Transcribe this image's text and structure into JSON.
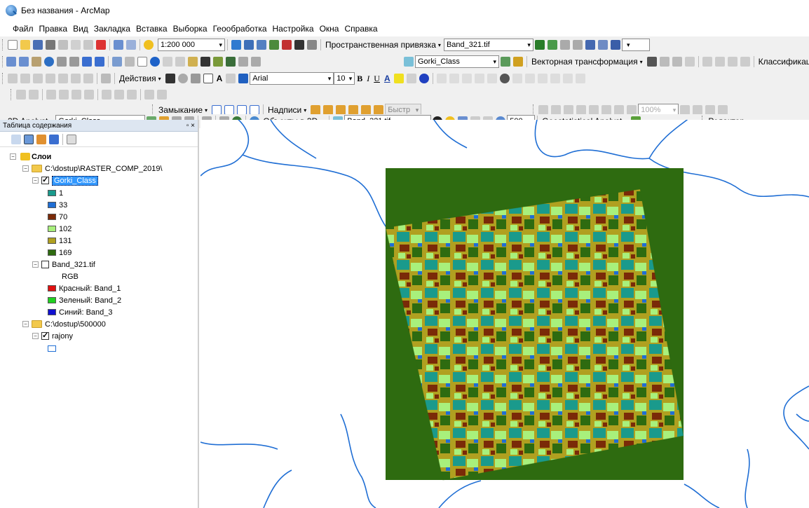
{
  "window": {
    "title": "Без названия - ArcMap"
  },
  "menu": [
    "Файл",
    "Правка",
    "Вид",
    "Закладка",
    "Вставка",
    "Выборка",
    "Геообработка",
    "Настройка",
    "Окна",
    "Справка"
  ],
  "toolbar1": {
    "scale": "1:200 000",
    "spatial_ref_label": "Пространственная привязка",
    "layer_select": "Band_321.tif"
  },
  "toolbar2": {
    "layer_select": "Gorki_Class",
    "vector_transform": "Векторная трансформация",
    "classify": "Классификаци"
  },
  "toolbar3": {
    "actions": "Действия",
    "font": "Arial",
    "font_size": "10",
    "bold": "B",
    "italic": "I",
    "underline": "U"
  },
  "toolbar5": {
    "snapping": "Замыкание",
    "labels": "Надписи",
    "fast": "Быстр",
    "zoom_pct": "100%"
  },
  "toolbar6": {
    "analyst3d": "3D Analyst",
    "layer_3d": "Gorki_Class",
    "objects3d": "Объекты в 3D...",
    "band": "Band_321.tif",
    "res": "500",
    "geostat": "Geostatistical Analyst",
    "editor": "Редактор"
  },
  "toc": {
    "title": "Таблица содержания",
    "layers_label": "Слои",
    "folder1": "C:\\dostup\\RASTER_COMP_2019\\",
    "layer_class": "Gorki_Class",
    "classes": [
      {
        "label": "1",
        "color": "#1a9a8c"
      },
      {
        "label": "33",
        "color": "#1f6ed4"
      },
      {
        "label": "70",
        "color": "#7a2a08"
      },
      {
        "label": "102",
        "color": "#a8f07c"
      },
      {
        "label": "131",
        "color": "#b0a020"
      },
      {
        "label": "169",
        "color": "#2e6b10"
      }
    ],
    "layer_band": "Band_321.tif",
    "rgb_label": "RGB",
    "bands": [
      {
        "label": "Красный:  Band_1",
        "color": "#e01010"
      },
      {
        "label": "Зеленый: Band_2",
        "color": "#20d020"
      },
      {
        "label": "Синий:  Band_3",
        "color": "#1010d0"
      }
    ],
    "folder2": "C:\\dostup\\500000",
    "layer_rajony": "rajony"
  }
}
